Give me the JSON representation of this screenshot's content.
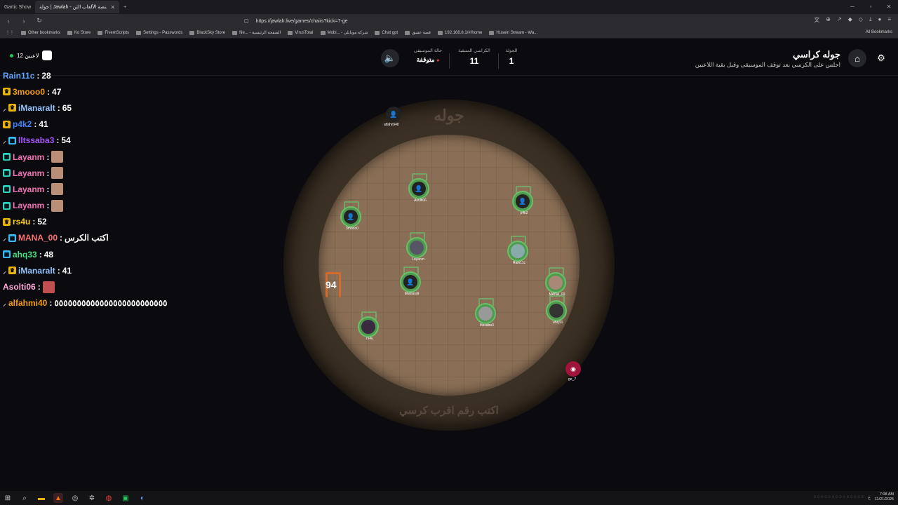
{
  "tabs": [
    {
      "label": "Gartic Show",
      "active": false
    },
    {
      "label": "جولة | Jawlah - منصة الألعاب الثن...",
      "active": true
    }
  ],
  "address": {
    "url": "https://jawlah.live/games/chairs?kick=7-ge"
  },
  "bookmarks": [
    "Other bookmarks",
    "Ko Store",
    "FivemScripts",
    "Settings - Passwords",
    "BlackSky Store",
    "Ne... - الصفحة الرئيسية",
    "VirusTotal",
    "Mobi... - شركة موبايلي",
    "Chat gpt",
    "قصة عشق",
    "192.168.8.1/#/home",
    "Husein Stream - Wa..."
  ],
  "bookmarks_all": "All Bookmarks",
  "header": {
    "title": "جوله كراسي",
    "subtitle": "اجلس على الكرسي بعد توقف الموسيقى وقبل بقية اللاعبين",
    "round_label": "الجولة",
    "round_value": "1",
    "chairs_label": "الكراسي المتبقية",
    "chairs_value": "11",
    "music_label": "حالة الموسيقى",
    "music_value": "متوقفة"
  },
  "players_pill": {
    "label": "12 لاعبين"
  },
  "chat": [
    {
      "user": "Rain11c",
      "text": "28",
      "color": "#60a5fa",
      "badge": "",
      "sword": false
    },
    {
      "user": "3mooo0",
      "text": "47",
      "color": "#f59e0b",
      "badge": "gold",
      "sword": false
    },
    {
      "user": "iManaralt",
      "text": "65",
      "color": "#93c5fd",
      "badge": "gold",
      "sword": true
    },
    {
      "user": "p4k2",
      "text": "41",
      "color": "#3b82f6",
      "badge": "gold",
      "sword": false
    },
    {
      "user": "lltssaba3",
      "text": "54",
      "color": "#a855f7",
      "badge": "blue",
      "sword": true
    },
    {
      "user": "Layanm",
      "text": "",
      "color": "#f472b6",
      "badge": "teal",
      "sword": false,
      "thumb": true
    },
    {
      "user": "Layanm",
      "text": "",
      "color": "#f472b6",
      "badge": "teal",
      "sword": false,
      "thumb": true
    },
    {
      "user": "Layanm",
      "text": "",
      "color": "#f472b6",
      "badge": "teal",
      "sword": false,
      "thumb": true
    },
    {
      "user": "Layanm",
      "text": "",
      "color": "#f472b6",
      "badge": "teal",
      "sword": false,
      "thumb": true
    },
    {
      "user": "rs4u",
      "text": "52",
      "color": "#facc15",
      "badge": "gold",
      "sword": false
    },
    {
      "user": "MANA_00",
      "text": "اكتب الكرس",
      "color": "#f87171",
      "badge": "blue",
      "sword": true
    },
    {
      "user": "ahq33",
      "text": "48",
      "color": "#4ade80",
      "badge": "blue",
      "sword": false
    },
    {
      "user": "iManaralt",
      "text": "41",
      "color": "#93c5fd",
      "badge": "gold",
      "sword": true
    },
    {
      "user": "Asolti06",
      "text": "",
      "color": "#f9a8d4",
      "badge": "",
      "sword": false,
      "thumb": true,
      "thumbRed": true
    },
    {
      "user": "alfahmi40",
      "text": "٥٥٥٥٥٥٥٥٥٥٥٥٥٥٥٥٥٥٥٥٥٥٥٥٥",
      "color": "#f59e0b",
      "badge": "",
      "sword": true
    }
  ],
  "board": {
    "title": "جوله",
    "hint": "اكتب رقم اقرب كرسي",
    "free_chair_number": "94",
    "standing_players": [
      {
        "name": "alfahmi40",
        "icon": "ghost-icon"
      },
      {
        "name": "ge_7",
        "icon": "avatar-icon"
      }
    ],
    "seated_players": [
      {
        "name": "Asolti06"
      },
      {
        "name": "p4k2"
      },
      {
        "name": "3mooo0"
      },
      {
        "name": "Layanm"
      },
      {
        "name": "Rain11c"
      },
      {
        "name": "iManaralt"
      },
      {
        "name": "MANA_00"
      },
      {
        "name": "lltssaba3"
      },
      {
        "name": "ahq33"
      },
      {
        "name": "rs4u"
      }
    ]
  },
  "taskbar": {
    "time": "7:08 AM",
    "date": "11/21/2025"
  }
}
